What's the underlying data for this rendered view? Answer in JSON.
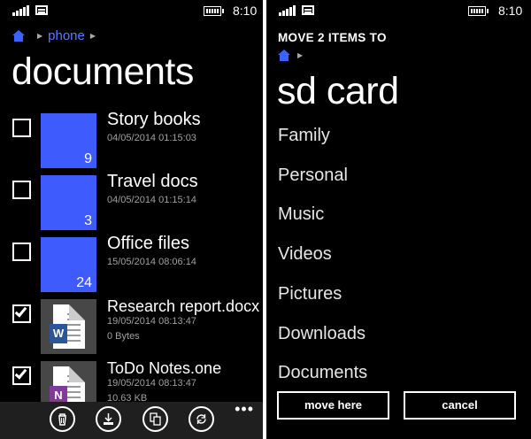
{
  "status": {
    "time": "8:10"
  },
  "left": {
    "breadcrumb": {
      "location": "phone"
    },
    "title": "documents",
    "items": [
      {
        "checked": false,
        "type": "folder",
        "name": "Story books",
        "date": "04/05/2014 01:15:03",
        "count": "9"
      },
      {
        "checked": false,
        "type": "folder",
        "name": "Travel docs",
        "date": "04/05/2014 01:15:14",
        "count": "3"
      },
      {
        "checked": false,
        "type": "folder",
        "name": "Office files",
        "date": "15/05/2014 08:06:14",
        "count": "24"
      },
      {
        "checked": true,
        "type": "file",
        "name": "Research report.docx",
        "date": "19/05/2014 08:13:47",
        "size": "0 Bytes",
        "app": "W",
        "app_color": "#2b579a"
      },
      {
        "checked": true,
        "type": "file",
        "name": "ToDo Notes.one",
        "date": "19/05/2014 08:13:47",
        "size": "10.63 KB",
        "app": "N",
        "app_color": "#7f3a9b"
      }
    ],
    "appbar": [
      "delete-icon",
      "download-icon",
      "copy-icon",
      "sync-icon"
    ],
    "more": "•••"
  },
  "right": {
    "heading": "MOVE 2 ITEMS TO",
    "title": "sd card",
    "folders": [
      "Family",
      "Personal",
      "Music",
      "Videos",
      "Pictures",
      "Downloads",
      "Documents"
    ],
    "move_here": "move here",
    "cancel": "cancel"
  },
  "colors": {
    "accent": "#3e5bfe",
    "background": "#000000",
    "appbar": "#1f1f1f"
  }
}
